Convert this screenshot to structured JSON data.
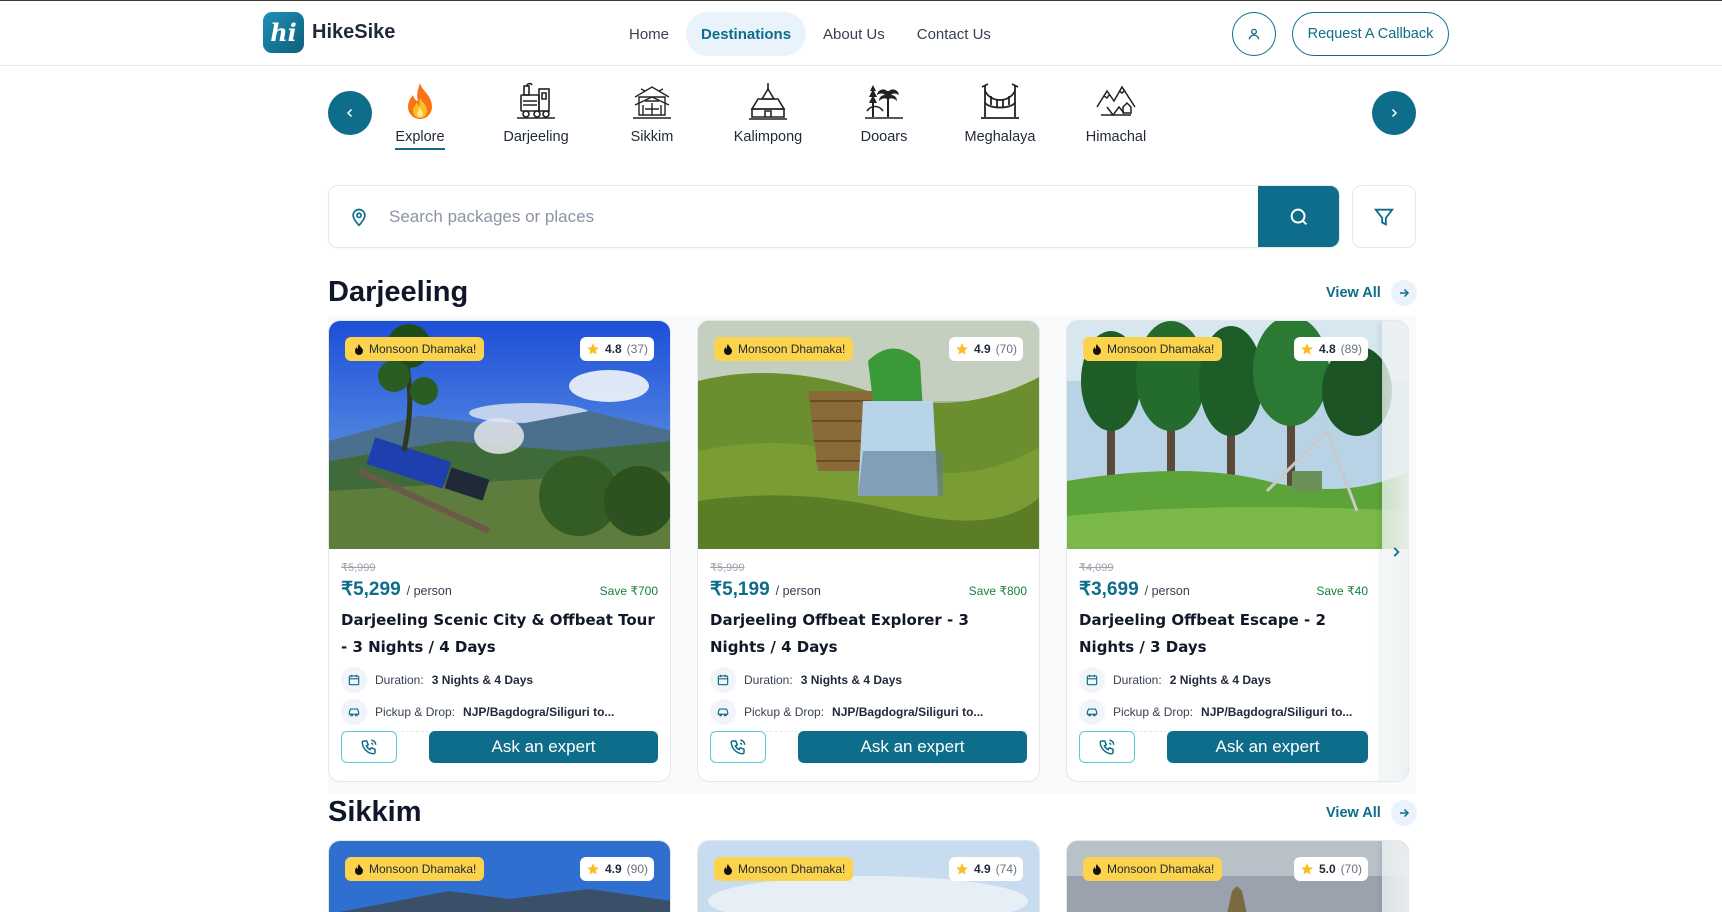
{
  "header": {
    "brand": "HikeSike",
    "logo_glyph": "hi",
    "nav": [
      {
        "label": "Home",
        "active": false
      },
      {
        "label": "Destinations",
        "active": true
      },
      {
        "label": "About Us",
        "active": false
      },
      {
        "label": "Contact Us",
        "active": false
      }
    ],
    "callback_label": "Request A Callback"
  },
  "categories": [
    {
      "label": "Explore",
      "icon": "flame-icon",
      "active": true
    },
    {
      "label": "Darjeeling",
      "icon": "toy-train-icon",
      "active": false
    },
    {
      "label": "Sikkim",
      "icon": "monastery-icon",
      "active": false
    },
    {
      "label": "Kalimpong",
      "icon": "temple-icon",
      "active": false
    },
    {
      "label": "Dooars",
      "icon": "forest-icon",
      "active": false
    },
    {
      "label": "Meghalaya",
      "icon": "bridge-icon",
      "active": false
    },
    {
      "label": "Himachal",
      "icon": "mountains-icon",
      "active": false
    }
  ],
  "search": {
    "placeholder": "Search packages or places"
  },
  "sections": [
    {
      "title": "Darjeeling",
      "view_all": "View All",
      "cards": [
        {
          "badge": "Monsoon Dhamaka!",
          "rating": "4.8",
          "reviews": "(37)",
          "old_price": "₹5,999",
          "price": "₹5,299",
          "per": "/ person",
          "save": "Save ₹700",
          "title": "Darjeeling Scenic City & Offbeat Tour - 3 Nights / 4 Days",
          "duration_label": "Duration:",
          "duration": "3 Nights & 4 Days",
          "pickup_label": "Pickup & Drop:",
          "pickup": "NJP/Bagdogra/Siliguri to...",
          "cta": "Ask an expert"
        },
        {
          "badge": "Monsoon Dhamaka!",
          "rating": "4.9",
          "reviews": "(70)",
          "old_price": "₹5,999",
          "price": "₹5,199",
          "per": "/ person",
          "save": "Save ₹800",
          "title": "Darjeeling Offbeat Explorer - 3 Nights / 4 Days",
          "duration_label": "Duration:",
          "duration": "3 Nights & 4 Days",
          "pickup_label": "Pickup & Drop:",
          "pickup": "NJP/Bagdogra/Siliguri to...",
          "cta": "Ask an expert"
        },
        {
          "badge": "Monsoon Dhamaka!",
          "rating": "4.8",
          "reviews": "(89)",
          "old_price": "₹4,099",
          "price": "₹3,699",
          "per": "/ person",
          "save": "Save ₹40",
          "title": "Darjeeling Offbeat Escape - 2 Nights / 3 Days",
          "duration_label": "Duration:",
          "duration": "2 Nights & 4 Days",
          "pickup_label": "Pickup & Drop:",
          "pickup": "NJP/Bagdogra/Siliguri to...",
          "cta": "Ask an expert"
        }
      ]
    },
    {
      "title": "Sikkim",
      "view_all": "View All",
      "cards": [
        {
          "badge": "Monsoon Dhamaka!",
          "rating": "4.9",
          "reviews": "(90)"
        },
        {
          "badge": "Monsoon Dhamaka!",
          "rating": "4.9",
          "reviews": "(74)"
        },
        {
          "badge": "Monsoon Dhamaka!",
          "rating": "5.0",
          "reviews": "(70)"
        }
      ]
    }
  ],
  "colors": {
    "primary": "#0e6d8a",
    "badge": "#fcd34d",
    "save_green": "#16803c"
  }
}
